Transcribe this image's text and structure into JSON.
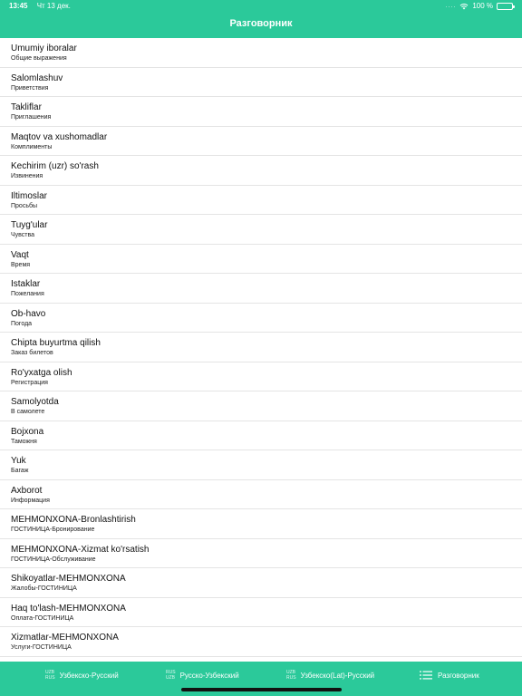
{
  "status": {
    "time": "13:45",
    "date": "Чт 13 дек.",
    "dots": "....",
    "battery": "100 %"
  },
  "header": {
    "title": "Разговорник"
  },
  "items": [
    {
      "title": "Umumiy iboralar",
      "sub": "Общие выражения"
    },
    {
      "title": "Salomlashuv",
      "sub": "Приветствия"
    },
    {
      "title": "Takliflar",
      "sub": "Приглашения"
    },
    {
      "title": "Maqtov va xushomadlar",
      "sub": "Комплименты"
    },
    {
      "title": "Kechirim (uzr) so'rash",
      "sub": "Извинения"
    },
    {
      "title": "Iltimoslar",
      "sub": "Просьбы"
    },
    {
      "title": "Tuyg'ular",
      "sub": "Чувства"
    },
    {
      "title": "Vaqt",
      "sub": "Время"
    },
    {
      "title": "Istaklar",
      "sub": "Пожелания"
    },
    {
      "title": "Ob-havo",
      "sub": "Погода"
    },
    {
      "title": "Chipta buyurtma qilish",
      "sub": "Заказ билетов"
    },
    {
      "title": "Ro'yxatga olish",
      "sub": "Регистрация"
    },
    {
      "title": "Samolyotda",
      "sub": "В  самолете"
    },
    {
      "title": "Bojxona",
      "sub": "Таможня"
    },
    {
      "title": "Yuk",
      "sub": "Багаж"
    },
    {
      "title": "Axborot",
      "sub": "Информация"
    },
    {
      "title": "MEHMONXONA-Bronlashtirish",
      "sub": "ГОСТИНИЦА-Бронирование"
    },
    {
      "title": "MEHMONXONA-Xizmat ko'rsatish",
      "sub": "ГОСТИНИЦА-Обслуживание"
    },
    {
      "title": "Shikoyatlar-MEHMONXONA",
      "sub": "Жалобы-ГОСТИНИЦА"
    },
    {
      "title": "Haq to'lash-MEHMONXONA",
      "sub": "Оплата-ГОСТИНИЦА"
    },
    {
      "title": "Xizmatlar-MEHMONXONA",
      "sub": "Услуги-ГОСТИНИЦА"
    }
  ],
  "tabs": [
    {
      "icon_top": "UZB",
      "icon_bottom": "RUS",
      "label": "Узбекско-Русский"
    },
    {
      "icon_top": "RUS",
      "icon_bottom": "UZB",
      "label": "Русско-Узбекский"
    },
    {
      "icon_top": "UZB",
      "icon_bottom": "RUS",
      "label": "Узбекско(Lat)-Русский"
    },
    {
      "label": "Разговорник"
    }
  ],
  "colors": {
    "accent": "#2bc99a"
  }
}
